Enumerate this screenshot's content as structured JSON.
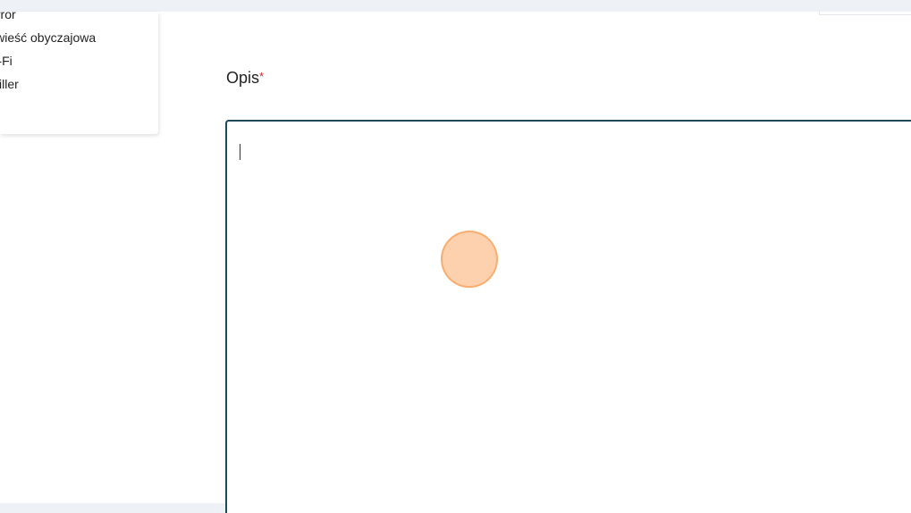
{
  "genre_dropdown": {
    "items": [
      {
        "label": "Horror"
      },
      {
        "label": "Powieść obyczajowa"
      },
      {
        "label": "Sci-Fi"
      },
      {
        "label": "Thriller"
      }
    ]
  },
  "description_field": {
    "label": "Opis",
    "required_mark": "*",
    "value": ""
  },
  "colors": {
    "textarea_border": "#1f4a5e",
    "required": "#e02424",
    "click_indicator": "#fcb278"
  }
}
